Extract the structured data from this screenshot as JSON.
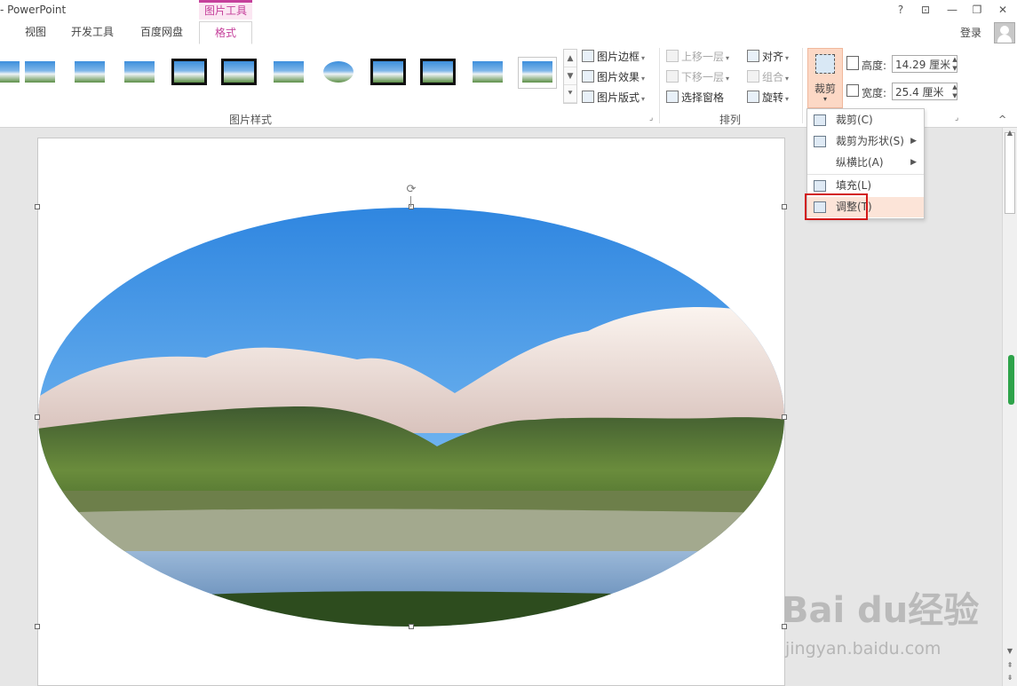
{
  "app": {
    "title": "- PowerPoint",
    "tool_context": "图片工具"
  },
  "window": {
    "help": "?",
    "ribbon_display": "⊡",
    "minimize": "—",
    "restore": "❐",
    "close": "✕"
  },
  "tabs": [
    {
      "label": "视图"
    },
    {
      "label": "开发工具"
    },
    {
      "label": "百度网盘"
    },
    {
      "label": "格式",
      "active": true
    }
  ],
  "account": {
    "login": "登录"
  },
  "ribbon": {
    "picture_styles": {
      "label": "图片样式",
      "styles_count": 12,
      "scroll_up": "▲",
      "scroll_down": "▼",
      "more": "⯆"
    },
    "picture_tools": [
      {
        "label": "图片边框"
      },
      {
        "label": "图片效果"
      },
      {
        "label": "图片版式"
      }
    ],
    "arrange": {
      "label": "排列",
      "bring_forward": "上移一层",
      "send_backward": "下移一层",
      "selection_pane": "选择窗格",
      "align": "对齐",
      "group": "组合",
      "rotate": "旋转"
    },
    "size": {
      "crop_label": "裁剪",
      "height_label": "高度:",
      "height_value": "14.29 厘米",
      "width_label": "宽度:",
      "width_value": "25.4 厘米",
      "launcher": "⌟"
    },
    "collapse": "^"
  },
  "crop_menu": {
    "items": [
      {
        "label": "裁剪(C)",
        "submenu": false
      },
      {
        "label": "裁剪为形状(S)",
        "submenu": true
      },
      {
        "label": "纵横比(A)",
        "submenu": true
      },
      {
        "label": "填充(L)",
        "submenu": false
      },
      {
        "label": "调整(T)",
        "submenu": false,
        "highlighted": true
      }
    ]
  },
  "colors": {
    "accent": "#c5409b",
    "menu_hover": "#fce4d8",
    "crop_active": "#fcd8c5",
    "highlight_box": "#d21818"
  },
  "watermark": {
    "logo": "Bai du经验",
    "url": "jingyan.baidu.com"
  }
}
